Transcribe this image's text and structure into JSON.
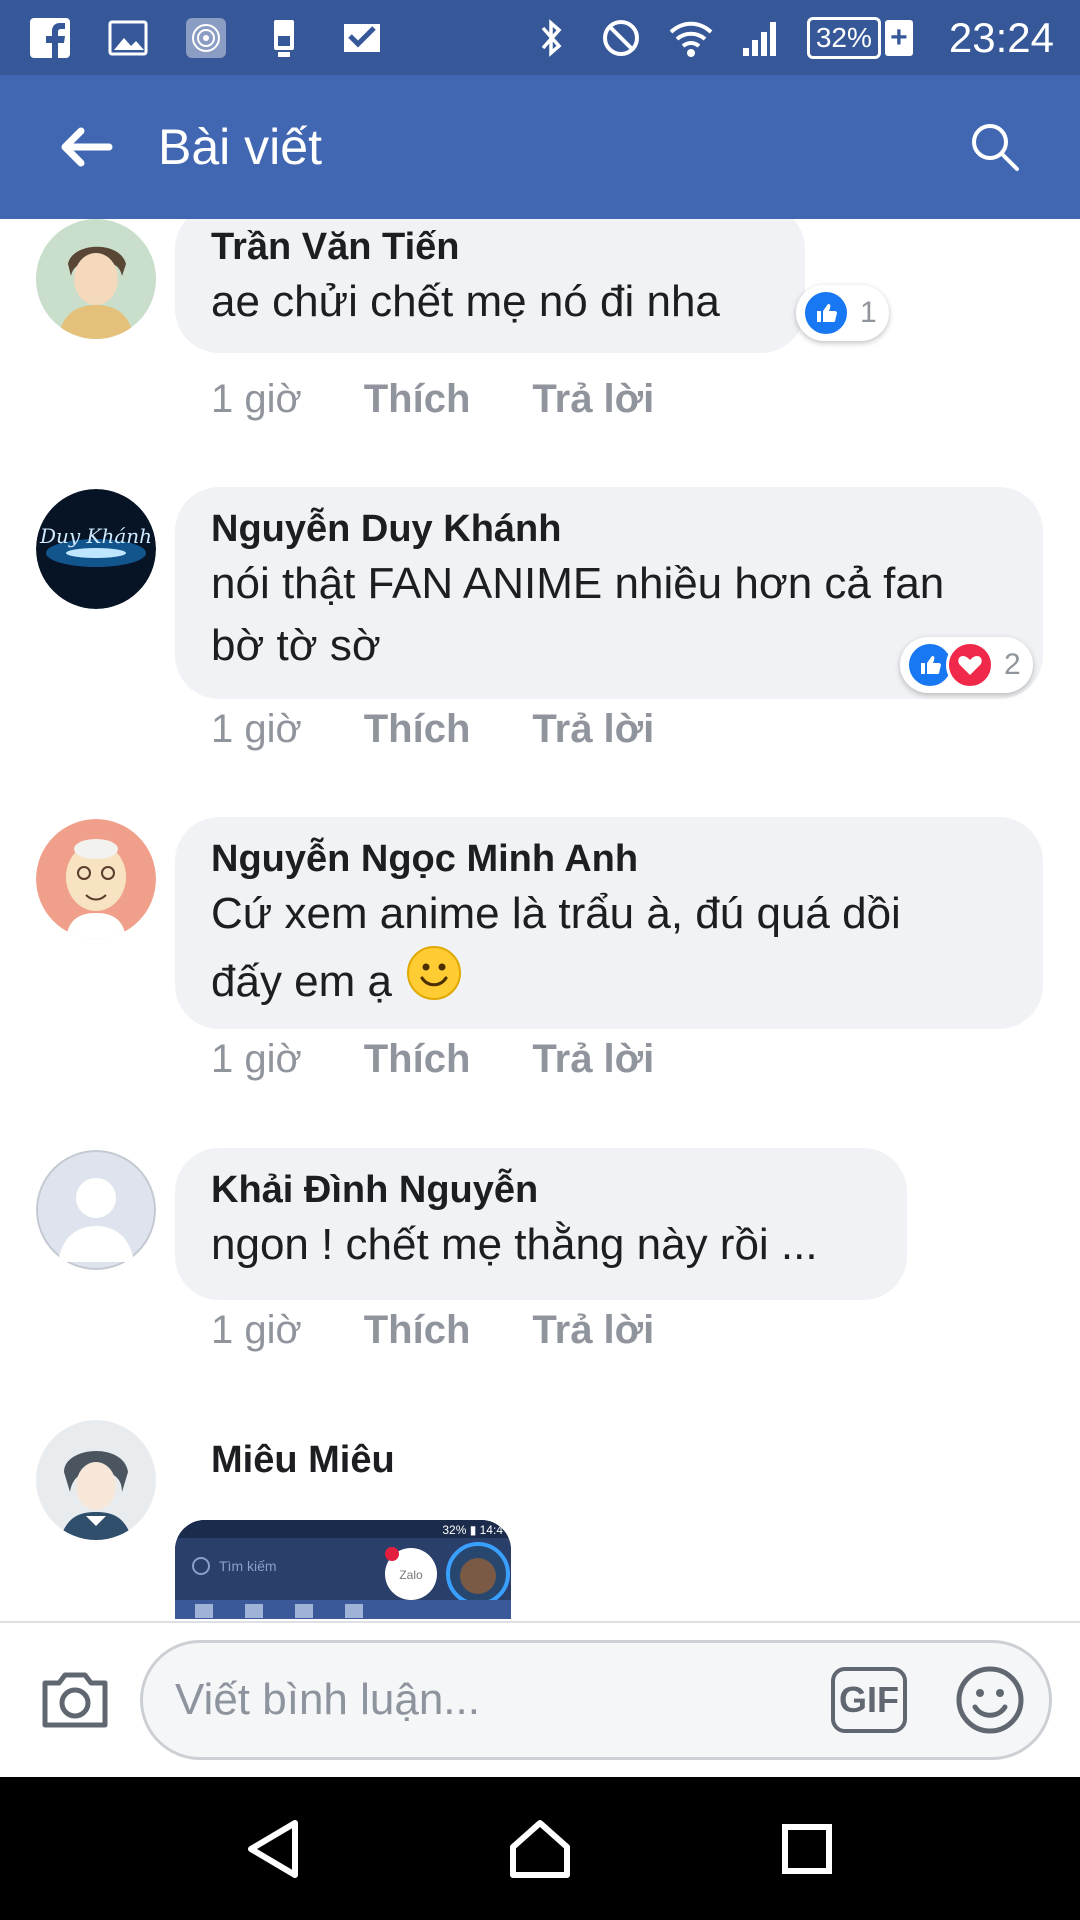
{
  "status_bar": {
    "battery_percent": "32%",
    "time": "23:24"
  },
  "app_bar": {
    "title": "Bài viết"
  },
  "comments": [
    {
      "author": "Trần Văn Tiến",
      "text": "ae chửi chết mẹ nó đi nha",
      "time": "1 giờ",
      "like_label": "Thích",
      "reply_label": "Trả lời",
      "reaction_count": "1"
    },
    {
      "author": "Nguyễn Duy Khánh",
      "text_line1": "nói thật FAN ANIME nhiều hơn cả  fan",
      "text_line2": "bờ tờ sờ",
      "time": "1 giờ",
      "like_label": "Thích",
      "reply_label": "Trả lời",
      "reaction_count": "2"
    },
    {
      "author": "Nguyễn Ngọc Minh Anh",
      "text_line1": "Cứ xem anime là trẩu à, đú quá dồi",
      "text_line2": "đấy em ạ",
      "time": "1 giờ",
      "like_label": "Thích",
      "reply_label": "Trả lời"
    },
    {
      "author": "Khải Đình Nguyễn",
      "text": "ngon ! chết mẹ thằng này rồi ...",
      "time": "1 giờ",
      "like_label": "Thích",
      "reply_label": "Trả lời"
    },
    {
      "author": "Miêu Miêu",
      "attachment": {
        "search_placeholder": "Tìm kiếm",
        "status_text": "32% ▮ 14:4",
        "app_label": "Zalo"
      }
    }
  ],
  "composer": {
    "placeholder": "Viết bình luận...",
    "gif_label": "GIF"
  },
  "colors": {
    "status_bar": "#365899",
    "app_bar": "#4267b2",
    "bubble": "#f0f2f5",
    "meta_text": "#90949c",
    "like": "#1877f2",
    "love": "#f0284a"
  }
}
